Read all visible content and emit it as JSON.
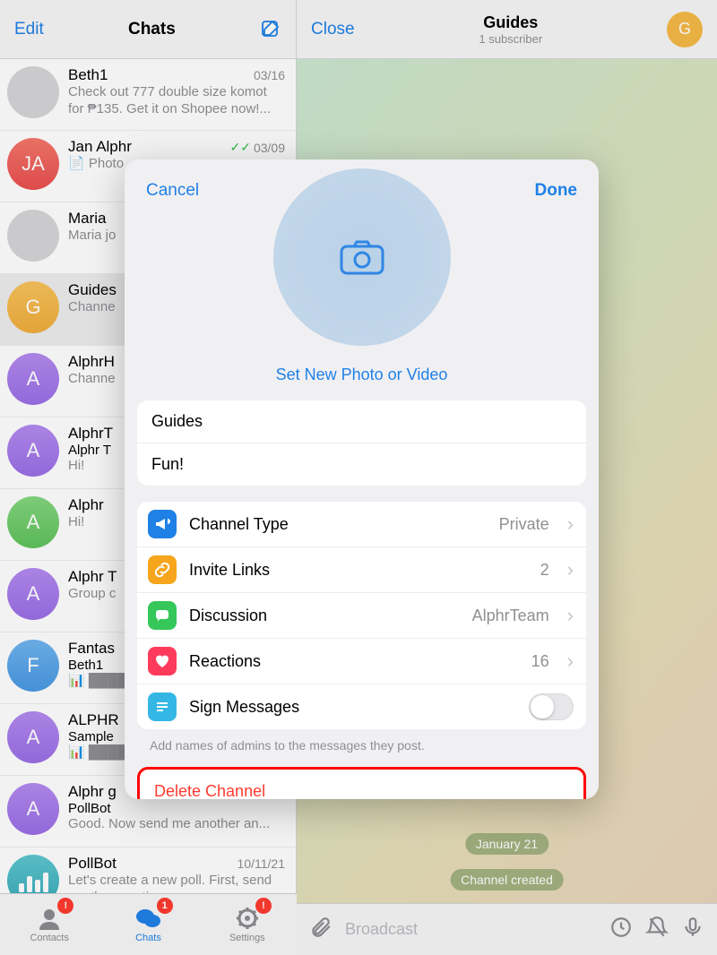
{
  "left": {
    "edit": "Edit",
    "title": "Chats",
    "chats": [
      {
        "name": "Beth1",
        "date": "03/16",
        "msg": "Check out 777 double size komot for ₱135. Get it on Shopee now!...",
        "initials": "",
        "color": "av-photo"
      },
      {
        "name": "Jan Alphr",
        "date": "03/09",
        "msg": "📄 Photo",
        "initials": "JA",
        "color": "av-red",
        "checks": true
      },
      {
        "name": "Maria",
        "date": "",
        "msg": "Maria jo",
        "initials": "",
        "color": "av-photo"
      },
      {
        "name": "Guides",
        "date": "",
        "msg": "Channe",
        "initials": "G",
        "color": "av-yellow",
        "selected": true
      },
      {
        "name": "AlphrH",
        "date": "",
        "msg": "Channe",
        "initials": "A",
        "color": "av-purple"
      },
      {
        "name": "AlphrT",
        "date": "",
        "sub": "Alphr T",
        "msg": "Hi!",
        "initials": "A",
        "color": "av-purple"
      },
      {
        "name": "Alphr",
        "date": "",
        "msg": "Hi!",
        "initials": "A",
        "color": "av-green"
      },
      {
        "name": "Alphr T",
        "date": "",
        "msg": "Group c",
        "initials": "A",
        "color": "av-purple"
      },
      {
        "name": "Fantas",
        "date": "",
        "sub": "Beth1",
        "msg": "📊 ████",
        "initials": "F",
        "color": "av-blue"
      },
      {
        "name": "ALPHR",
        "date": "",
        "sub": "Sample",
        "msg": "📊 ████",
        "initials": "A",
        "color": "av-purple"
      },
      {
        "name": "Alphr g",
        "date": "",
        "sub": "PollBot",
        "msg": "Good. Now send me another an...",
        "initials": "A",
        "color": "av-purple"
      },
      {
        "name": "PollBot",
        "date": "10/11/21",
        "msg": "Let's create a new poll. First, send me the question.",
        "initials": "",
        "color": "av-teal",
        "poll": true
      }
    ],
    "tabs": {
      "contacts": {
        "label": "Contacts",
        "badge": "!"
      },
      "chats": {
        "label": "Chats",
        "badge": "1"
      },
      "settings": {
        "label": "Settings",
        "badge": "!"
      }
    }
  },
  "right": {
    "close": "Close",
    "title": "Guides",
    "subtitle": "1 subscriber",
    "avatar_letter": "G",
    "date_pill": "January 21",
    "service_msg": "Channel created",
    "broadcast_placeholder": "Broadcast"
  },
  "modal": {
    "cancel": "Cancel",
    "done": "Done",
    "set_photo": "Set New Photo or Video",
    "name": "Guides",
    "desc": "Fun!",
    "settings": {
      "channel_type": {
        "label": "Channel Type",
        "value": "Private"
      },
      "invite_links": {
        "label": "Invite Links",
        "value": "2"
      },
      "discussion": {
        "label": "Discussion",
        "value": "AlphrTeam"
      },
      "reactions": {
        "label": "Reactions",
        "value": "16"
      },
      "sign_messages": {
        "label": "Sign Messages"
      }
    },
    "hint": "Add names of admins to the messages they post.",
    "delete": "Delete Channel"
  }
}
